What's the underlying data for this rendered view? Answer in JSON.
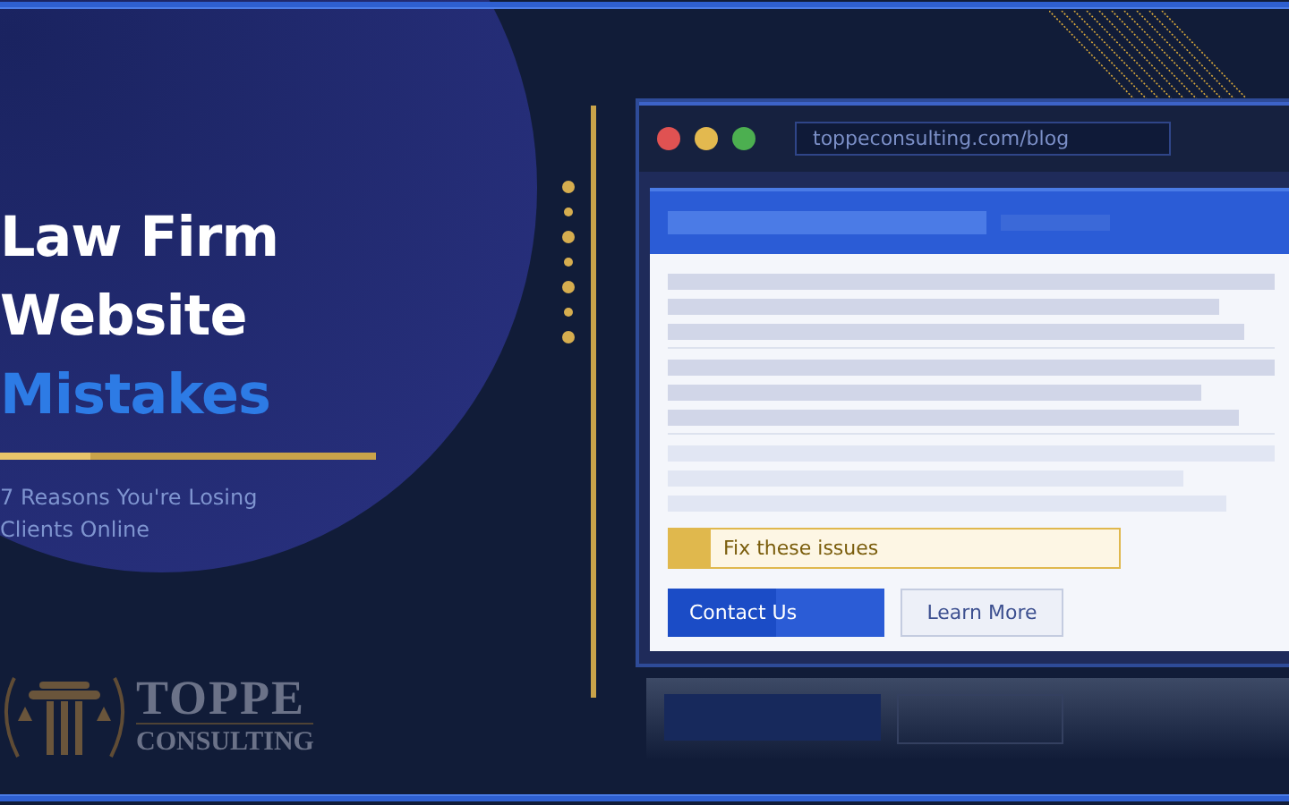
{
  "headline": [
    {
      "text": "Law Firm",
      "kind": "plain"
    },
    {
      "text": "Website",
      "kind": "plain"
    },
    {
      "text": "Mistakes",
      "kind": "accent"
    }
  ],
  "subtitle": "7 Reasons You're Losing Clients Online",
  "browser": {
    "dots": [
      {
        "color": "#e05252"
      },
      {
        "color": "#e3b94f"
      },
      {
        "color": "#4caf50"
      }
    ],
    "url": "toppeconsulting.com/blog",
    "notice": "Fix these issues",
    "buttons": [
      {
        "label": "Contact Us",
        "kind": "primary"
      },
      {
        "label": "Learn More",
        "kind": "secondary"
      }
    ]
  },
  "logo": {
    "name": "TOPPE",
    "tagline": "CONSULTING"
  }
}
